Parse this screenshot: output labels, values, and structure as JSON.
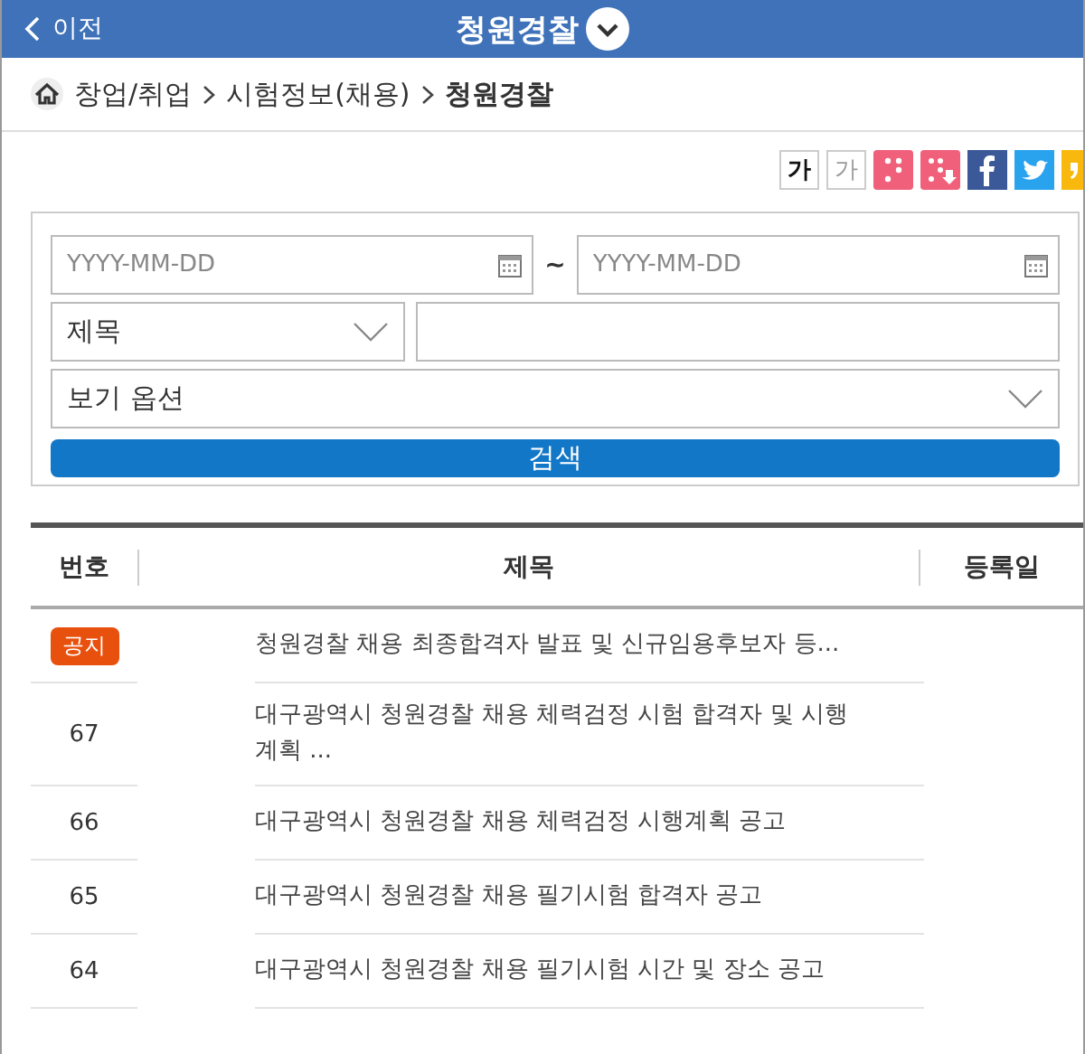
{
  "header": {
    "back": "이전",
    "title": "청원경찰"
  },
  "breadcrumb": [
    {
      "label": "창업/취업",
      "current": false
    },
    {
      "label": "시험정보(채용)",
      "current": false
    },
    {
      "label": "청원경찰",
      "current": true
    }
  ],
  "text_size_buttons": [
    {
      "label": "가",
      "kind": "larger"
    },
    {
      "label": "가",
      "kind": "smaller"
    }
  ],
  "search": {
    "date_from": {
      "placeholder": "YYYY-MM-DD"
    },
    "separator": "~",
    "date_to": {
      "placeholder": "YYYY-MM-DD"
    },
    "field_select": "제목",
    "view_select": "보기 옵션",
    "button": "검색"
  },
  "table": {
    "columns": [
      "번호",
      "제목",
      "등록일"
    ],
    "rows": [
      {
        "kind": "notice",
        "number": "공지",
        "title": "청원경찰 채용 최종합격자 발표 및 신규임용후보자 등..."
      },
      {
        "kind": "numbered",
        "number": "67",
        "title": "대구광역시 청원경찰 채용 체력검정 시험 합격자 및 시행계획 ..."
      },
      {
        "kind": "numbered",
        "number": "66",
        "title": "대구광역시 청원경찰 채용 체력검정 시행계획 공고"
      },
      {
        "kind": "numbered",
        "number": "65",
        "title": "대구광역시 청원경찰 채용 필기시험 합격자 공고"
      },
      {
        "kind": "numbered",
        "number": "64",
        "title": "대구광역시 청원경찰 채용 필기시험 시간 및 장소 공고"
      }
    ]
  }
}
